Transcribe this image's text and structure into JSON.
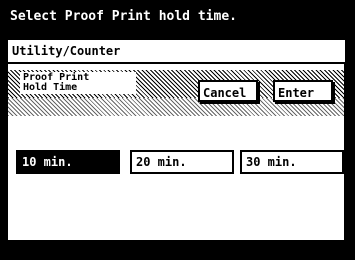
{
  "header": {
    "message": "Select Proof Print hold time."
  },
  "breadcrumb": {
    "label": "Utility/Counter"
  },
  "panel": {
    "title_line1": "Proof Print",
    "title_line2": "Hold Time",
    "cancel_label": "Cancel",
    "enter_label": "Enter"
  },
  "options": [
    {
      "label": "10 min.",
      "selected": true
    },
    {
      "label": "20 min.",
      "selected": false
    },
    {
      "label": "30 min.",
      "selected": false
    }
  ]
}
